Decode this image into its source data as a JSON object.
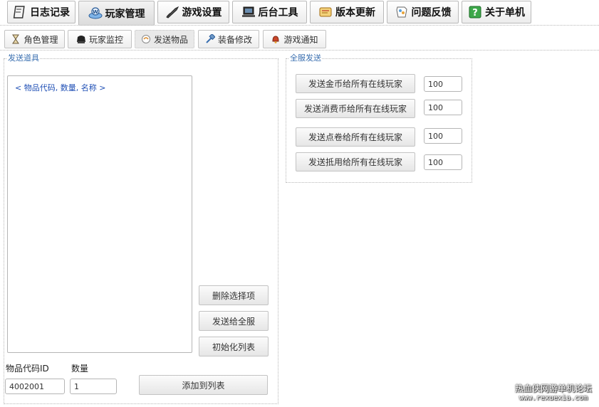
{
  "top_tabs": [
    {
      "label": "日志记录",
      "icon": "notebook-icon"
    },
    {
      "label": "玩家管理",
      "icon": "web-user-icon",
      "active": true
    },
    {
      "label": "游戏设置",
      "icon": "sword-icon"
    },
    {
      "label": "后台工具",
      "icon": "laptop-icon"
    },
    {
      "label": "版本更新",
      "icon": "scroll-icon"
    },
    {
      "label": "问题反馈",
      "icon": "feedback-icon"
    },
    {
      "label": "关于单机",
      "icon": "help-icon"
    }
  ],
  "sub_tabs": [
    {
      "label": "角色管理",
      "icon": "hourglass-icon"
    },
    {
      "label": "玩家监控",
      "icon": "monitor-icon"
    },
    {
      "label": "发送物品",
      "icon": "gift-icon",
      "active": true
    },
    {
      "label": "装备修改",
      "icon": "hammer-icon"
    },
    {
      "label": "游戏通知",
      "icon": "bell-icon"
    }
  ],
  "send_items": {
    "legend": "发送道具",
    "list_header": "< 物品代码, 数量, 名称 >",
    "delete_button": "删除选择项",
    "send_all_button": "发送给全服",
    "init_button": "初始化列表",
    "item_id_label": "物品代码ID",
    "quantity_label": "数量",
    "item_id_value": "4002001",
    "quantity_value": "1",
    "add_button": "添加到列表"
  },
  "server_send": {
    "legend": "全服发送",
    "rows": [
      {
        "button": "发送金币给所有在线玩家",
        "value": "100"
      },
      {
        "button": "发送消费币给所有在线玩家",
        "value": "100"
      },
      {
        "button": "发送点卷给所有在线玩家",
        "value": "100"
      },
      {
        "button": "发送抵用给所有在线玩家",
        "value": "100"
      }
    ]
  },
  "watermark": {
    "line1": "热血侠网游单机论坛",
    "line2": "www.rexuexia.com"
  }
}
